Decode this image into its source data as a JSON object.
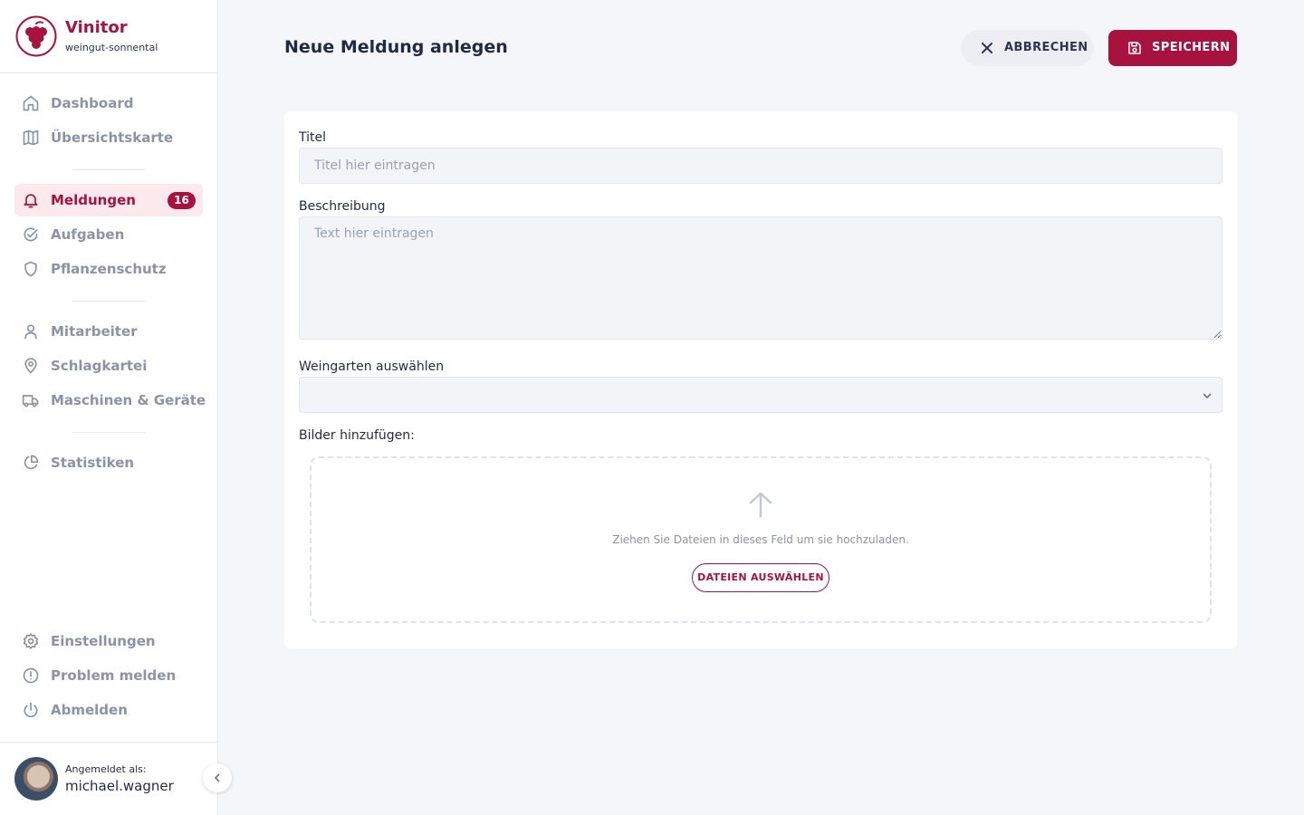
{
  "brand": {
    "name": "Vinitor",
    "subtitle": "weingut-sonnental"
  },
  "sidebar": {
    "items": [
      {
        "label": "Dashboard",
        "icon": "home-icon"
      },
      {
        "label": "Übersichtskarte",
        "icon": "map-icon"
      },
      {
        "label": "Meldungen",
        "icon": "bell-icon",
        "badge": "16",
        "active": true
      },
      {
        "label": "Aufgaben",
        "icon": "check-circle-icon"
      },
      {
        "label": "Pflanzenschutz",
        "icon": "shield-icon"
      },
      {
        "label": "Mitarbeiter",
        "icon": "user-icon"
      },
      {
        "label": "Schlagkartei",
        "icon": "map-pin-icon"
      },
      {
        "label": "Maschinen & Geräte",
        "icon": "truck-icon"
      },
      {
        "label": "Statistiken",
        "icon": "pie-chart-icon"
      }
    ],
    "bottom_items": [
      {
        "label": "Einstellungen",
        "icon": "gear-icon"
      },
      {
        "label": "Problem melden",
        "icon": "alert-circle-icon"
      },
      {
        "label": "Abmelden",
        "icon": "power-icon"
      }
    ],
    "user": {
      "caption": "Angemeldet als:",
      "name": "michael.wagner"
    }
  },
  "header": {
    "title": "Neue Meldung anlegen",
    "cancel_label": "ABBRECHEN",
    "save_label": "SPEICHERN"
  },
  "form": {
    "title_label": "Titel",
    "title_placeholder": "Titel hier eintragen",
    "title_value": "",
    "description_label": "Beschreibung",
    "description_placeholder": "Text hier eintragen",
    "description_value": "",
    "vineyard_label": "Weingarten auswählen",
    "vineyard_value": "",
    "images_label": "Bilder hinzufügen:",
    "dropzone_text": "Ziehen Sie Dateien in dieses Feld um sie hochzuladen.",
    "dropzone_button": "DATEIEN AUSWÄHLEN"
  },
  "colors": {
    "accent": "#a8123e",
    "accent_light": "#fbe9ee",
    "muted_text": "#8a93a8",
    "background": "#f5f6f9"
  }
}
